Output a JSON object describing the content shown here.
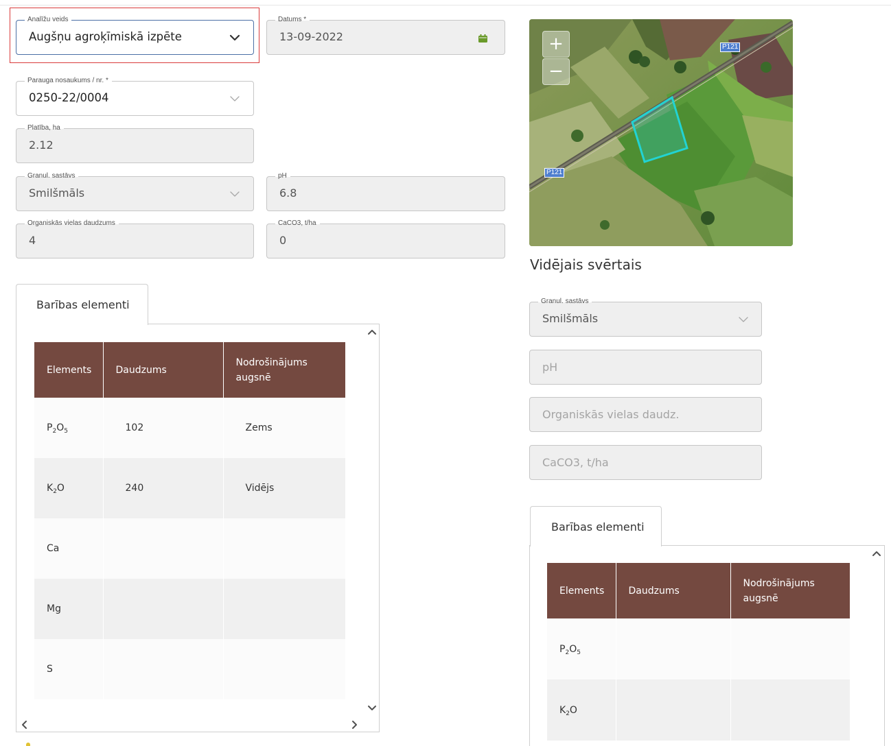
{
  "form": {
    "analysis_type": {
      "label": "Analīžu veids",
      "value": "Augšņu agroķīmiskā izpēte"
    },
    "date": {
      "label": "Datums *",
      "value": "13-09-2022"
    },
    "sample_name": {
      "label": "Parauga nosaukums / nr. *",
      "value": "0250-22/0004"
    },
    "area": {
      "label": "Platība, ha",
      "value": "2.12"
    },
    "texture": {
      "label": "Granul. sastāvs",
      "value": "Smilšmāls"
    },
    "ph": {
      "label": "pH",
      "value": "6.8"
    },
    "organic_matter": {
      "label": "Organiskās vielas daudzums",
      "value": "4"
    },
    "caco3": {
      "label": "CaCO3, t/ha",
      "value": "0"
    }
  },
  "map": {
    "zoom_in": "+",
    "zoom_out": "−",
    "road_label_top": "P121",
    "road_label_left": "P121"
  },
  "nutrients": {
    "tab_label": "Barības elementi",
    "columns": [
      "Elements",
      "Daudzums",
      "Nodrošinājums augsnē"
    ],
    "rows": [
      {
        "element_base": [
          "P",
          "O"
        ],
        "element_subs": [
          "2",
          "5"
        ],
        "amount": "102",
        "level": "Zems"
      },
      {
        "element_base": [
          "K",
          "O"
        ],
        "element_subs": [
          "2",
          ""
        ],
        "amount": "240",
        "level": "Vidējs"
      },
      {
        "element": "Ca",
        "amount": "",
        "level": ""
      },
      {
        "element": "Mg",
        "amount": "",
        "level": ""
      },
      {
        "element": "S",
        "amount": "",
        "level": ""
      }
    ]
  },
  "weighted": {
    "heading": "Vidējais svērtais",
    "texture": {
      "label": "Granul. sastāvs",
      "value": "Smilšmāls"
    },
    "ph_placeholder": "pH",
    "organic_placeholder": "Organiskās vielas daudz.",
    "caco3_placeholder": "CaCO3, t/ha",
    "tab_label": "Barības elementi",
    "columns": [
      "Elements",
      "Daudzums",
      "Nodrošinājums augsnē"
    ],
    "rows": [
      {
        "element_base": [
          "P",
          "O"
        ],
        "element_subs": [
          "2",
          "5"
        ],
        "amount": "",
        "level": ""
      },
      {
        "element_base": [
          "K",
          "O"
        ],
        "element_subs": [
          "2",
          ""
        ],
        "amount": "",
        "level": ""
      }
    ]
  },
  "colors": {
    "table_header": "#744940",
    "focus_frame": "#d93a3a",
    "active_border": "#4a6fa5",
    "calendar_icon": "#6a9a2a",
    "parcel_outline": "#22d3d3"
  },
  "icons": [
    "chevron-down-icon",
    "calendar-icon",
    "chevron-up-icon",
    "chevron-left-icon",
    "chevron-right-icon"
  ]
}
